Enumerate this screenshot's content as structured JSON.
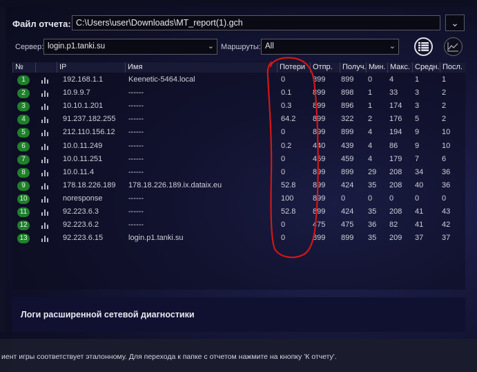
{
  "file": {
    "label": "Файл отчета:",
    "path": "C:\\Users\\user\\Downloads\\MT_report(1).gch"
  },
  "server": {
    "label": "Сервер:",
    "value": "login.p1.tanki.su"
  },
  "routes": {
    "label": "Маршруты:",
    "value": "All"
  },
  "icons": {
    "list_view": "list-icon",
    "graph_view": "chart-icon",
    "row_stats": "bar-chart-icon"
  },
  "table": {
    "headers": [
      "№",
      "",
      "IP",
      "Имя",
      "Потери",
      "Отпр.",
      "Получ.",
      "Мин.",
      "Макс.",
      "Средн.",
      "Посл."
    ],
    "rows": [
      [
        "1",
        "192.168.1.1",
        "Keenetic-5464.local",
        "0",
        "899",
        "899",
        "0",
        "4",
        "1",
        "1"
      ],
      [
        "2",
        "10.9.9.7",
        "------",
        "0.1",
        "899",
        "898",
        "1",
        "33",
        "3",
        "2"
      ],
      [
        "3",
        "10.10.1.201",
        "------",
        "0.3",
        "899",
        "896",
        "1",
        "174",
        "3",
        "2"
      ],
      [
        "4",
        "91.237.182.255",
        "------",
        "64.2",
        "899",
        "322",
        "2",
        "176",
        "5",
        "2"
      ],
      [
        "5",
        "212.110.156.12",
        "------",
        "0",
        "899",
        "899",
        "4",
        "194",
        "9",
        "10"
      ],
      [
        "6",
        "10.0.11.249",
        "------",
        "0.2",
        "440",
        "439",
        "4",
        "86",
        "9",
        "10"
      ],
      [
        "7",
        "10.0.11.251",
        "------",
        "0",
        "459",
        "459",
        "4",
        "179",
        "7",
        "6"
      ],
      [
        "8",
        "10.0.11.4",
        "------",
        "0",
        "899",
        "899",
        "29",
        "208",
        "34",
        "36"
      ],
      [
        "9",
        "178.18.226.189",
        "178.18.226.189.ix.dataix.eu",
        "52.8",
        "899",
        "424",
        "35",
        "208",
        "40",
        "36"
      ],
      [
        "10",
        "noresponse",
        "------",
        "100",
        "899",
        "0",
        "0",
        "0",
        "0",
        "0"
      ],
      [
        "11",
        "92.223.6.3",
        "------",
        "52.8",
        "899",
        "424",
        "35",
        "208",
        "41",
        "43"
      ],
      [
        "12",
        "92.223.6.2",
        "------",
        "0",
        "475",
        "475",
        "36",
        "82",
        "41",
        "42"
      ],
      [
        "13",
        "92.223.6.15",
        "login.p1.tanki.su",
        "0",
        "899",
        "899",
        "35",
        "209",
        "37",
        "37"
      ]
    ]
  },
  "logs": {
    "title": "Логи расширенной сетевой диагностики"
  },
  "status": {
    "text": "иент игры соответствует эталонному. Для перехода к папке с отчетом нажмите на кнопку 'К отчету'."
  },
  "colors": {
    "badge": "#1f7f2a",
    "annotation": "#d01818"
  }
}
